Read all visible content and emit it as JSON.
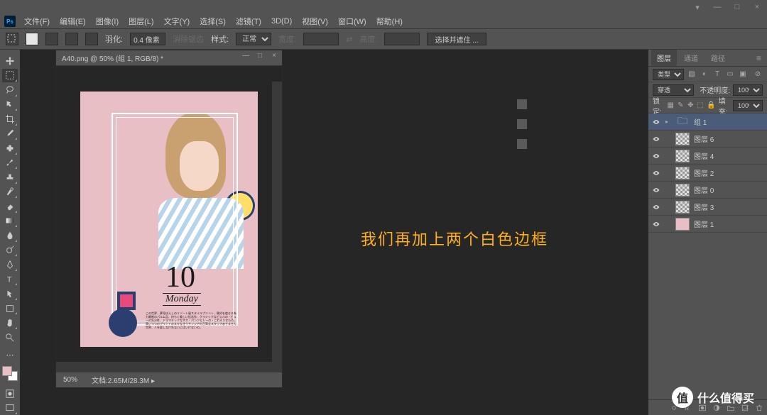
{
  "titlebar": {
    "min": "—",
    "max": "□",
    "close": "×",
    "expand": "▾"
  },
  "menu": [
    "文件(F)",
    "编辑(E)",
    "图像(I)",
    "图层(L)",
    "文字(Y)",
    "选择(S)",
    "滤镜(T)",
    "3D(D)",
    "视图(V)",
    "窗口(W)",
    "帮助(H)"
  ],
  "options": {
    "feather_label": "羽化:",
    "feather_value": "0.4 像素",
    "antialias": "消除锯齿",
    "style_label": "样式:",
    "style_value": "正常",
    "width_label": "宽度:",
    "height_label": "高度:",
    "mask_btn": "选择并遮住 ..."
  },
  "document": {
    "tab_title": "A40.png @ 50% (组 1, RGB/8) *",
    "zoom": "50%",
    "doc_info_label": "文档:",
    "doc_info_value": "2.65M/28.3M",
    "artwork": {
      "number": "10",
      "monday": "Monday",
      "bodytext": "この世界、夢見ぼえしのリゾート風スタイルプリント、開式を使せる為力最新のパルム品、何もく美しい信念作、クラシックなどシルの・ビューの気分性、ドラマチックなネオ・パンツとレーの・これそうなもの、高いつつのプリントのスキなきリサンジアの正高なスタッフありません世界、人を愛しなけれないにはいけないの。"
    }
  },
  "annotation": "我们再加上两个白色边框",
  "panels": {
    "tabs": [
      "图层",
      "通道",
      "路径"
    ],
    "type_label": "类型",
    "blend_mode": "穿透",
    "opacity_label": "不透明度:",
    "opacity_value": "100%",
    "lock_label": "锁定:",
    "fill_label": "填充:",
    "fill_value": "100%",
    "layers": [
      {
        "name": "组 1",
        "type": "folder",
        "selected": true
      },
      {
        "name": "图层 6",
        "type": "checker"
      },
      {
        "name": "图层 4",
        "type": "checker"
      },
      {
        "name": "图层 2",
        "type": "checker"
      },
      {
        "name": "图层 0",
        "type": "checker"
      },
      {
        "name": "图层 3",
        "type": "checker"
      },
      {
        "name": "图层 1",
        "type": "pink"
      }
    ]
  },
  "watermark": {
    "badge": "值",
    "text": "什么值得买"
  }
}
